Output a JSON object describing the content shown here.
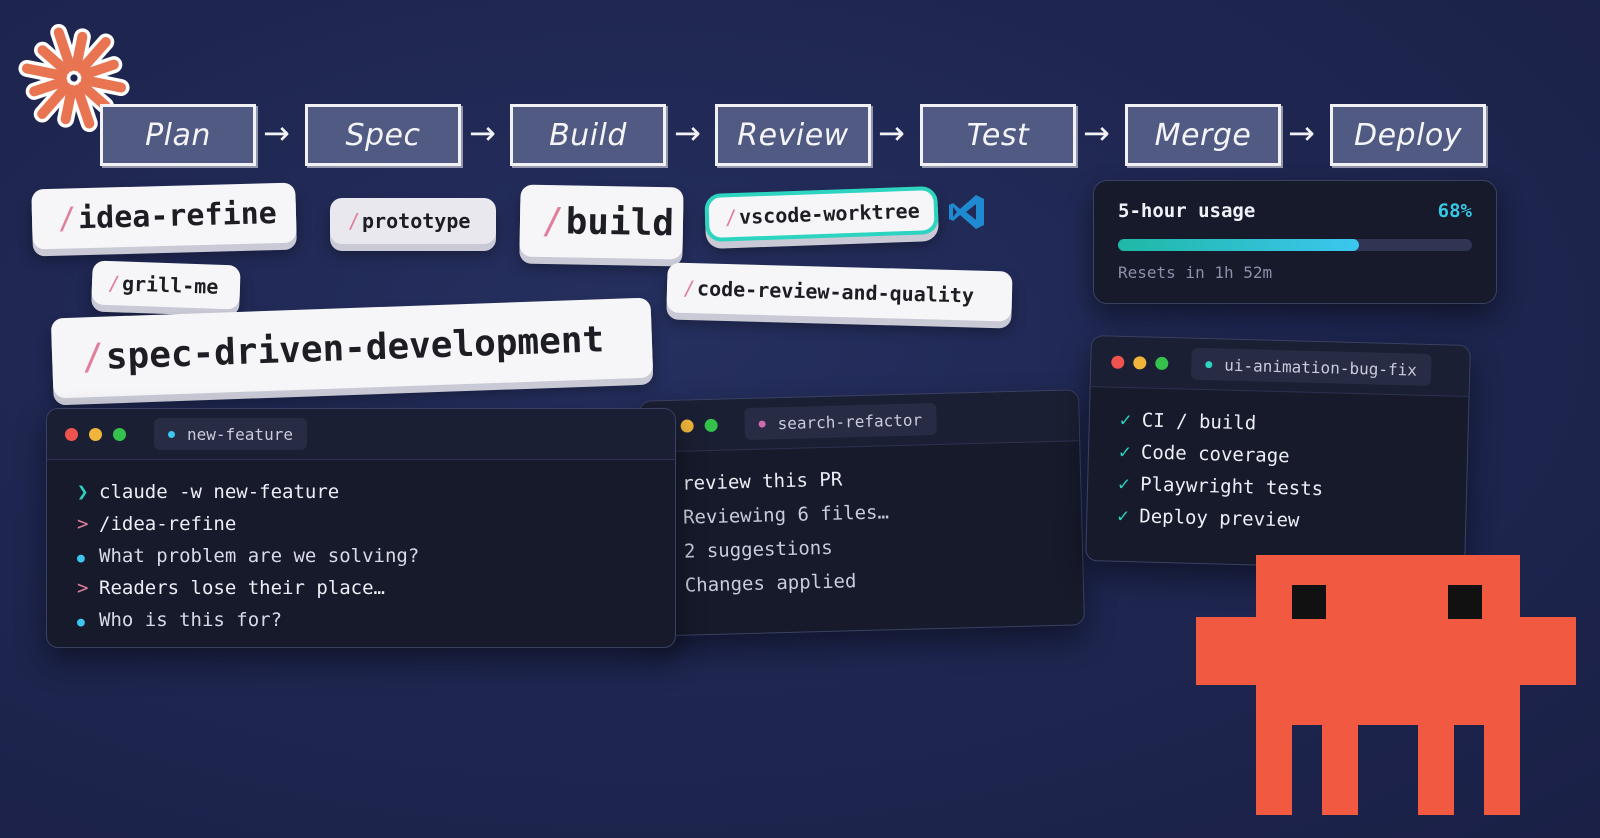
{
  "colors": {
    "background": "#1f2752",
    "stage_fill": "#505a82",
    "pill_slash": "#e07f9c",
    "accent_teal": "#2dd4bf",
    "progress_fill": "#22c8d8",
    "monster": "#f15a40",
    "logo": "#e97451",
    "vscode": "#1f8ad2"
  },
  "pipeline": {
    "stages": [
      "Plan",
      "Spec",
      "Build",
      "Review",
      "Test",
      "Merge",
      "Deploy"
    ],
    "arrow_glyph": "→"
  },
  "commands": {
    "slash": "/",
    "idea_refine": "idea-refine",
    "grill_me": "grill-me",
    "prototype": "prototype",
    "build": "build",
    "vscode_worktree": "vscode-worktree",
    "code_review": "code-review-and-quality",
    "spec_driven": "spec-driven-development"
  },
  "usage": {
    "title": "5-hour usage",
    "percent_label": "68%",
    "progress": 0.68,
    "reset_text": "Resets in 1h 52m"
  },
  "terminals": {
    "new_feature": {
      "tab": "new-feature",
      "lines": [
        {
          "prefix": "❯",
          "text": "claude -w new-feature"
        },
        {
          "prefix": ">",
          "text": "/idea-refine"
        },
        {
          "prefix": "●",
          "text": "What problem are we solving?"
        },
        {
          "prefix": ">",
          "text": "Readers lose their place…"
        },
        {
          "prefix": "●",
          "text": "Who is this for?"
        }
      ]
    },
    "search_refactor": {
      "tab": "search-refactor",
      "lines": [
        {
          "prefix": ">",
          "text": "review this PR"
        },
        {
          "prefix": "●",
          "text": "Reviewing 6 files…"
        },
        {
          "prefix": "●",
          "text": "2 suggestions"
        },
        {
          "prefix": "✓",
          "text": "Changes applied"
        }
      ]
    },
    "ui_animation": {
      "tab": "ui-animation-bug-fix",
      "lines": [
        {
          "prefix": "✓",
          "text": "CI / build"
        },
        {
          "prefix": "✓",
          "text": "Code coverage"
        },
        {
          "prefix": "✓",
          "text": "Playwright tests"
        },
        {
          "prefix": "✓",
          "text": "Deploy preview"
        }
      ]
    }
  },
  "icons": {
    "logo": "starburst-logo-icon",
    "vscode": "vscode-icon",
    "mascot": "pixel-monster-icon"
  }
}
